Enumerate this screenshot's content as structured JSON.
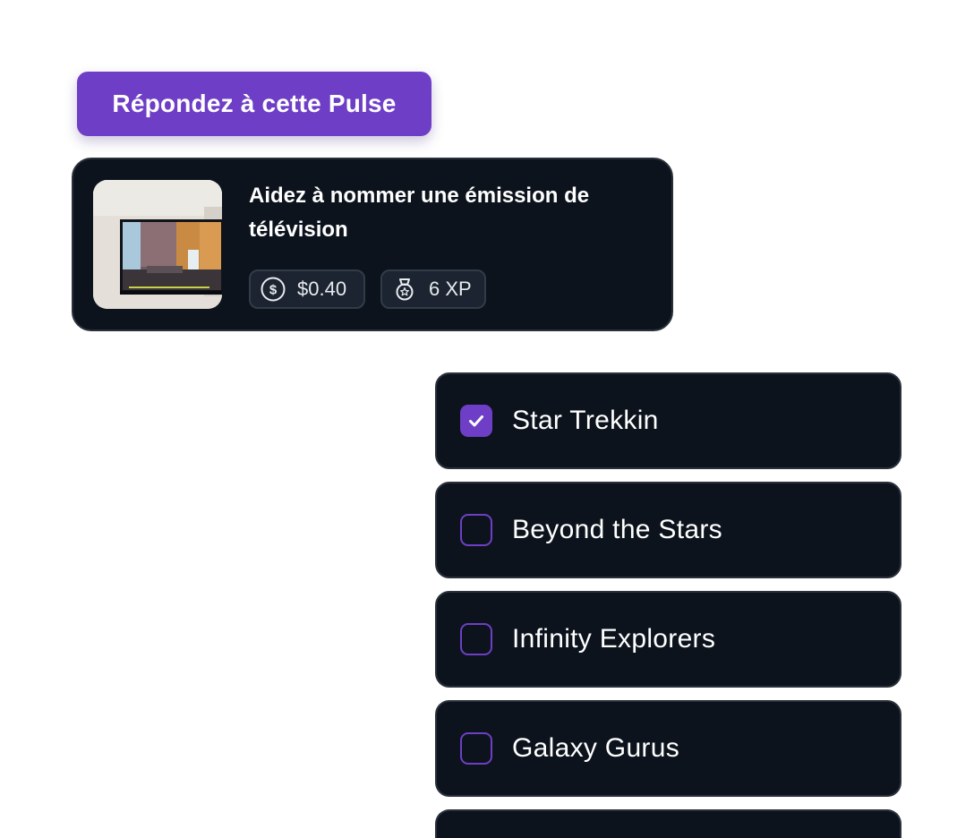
{
  "header": {
    "button_label": "Répondez à cette Pulse",
    "accent_color": "#6e3fc6"
  },
  "task": {
    "title": "Aidez à nommer une émission de télévision",
    "thumbnail_icon": "tv-photo",
    "reward": {
      "icon": "dollar-coin-icon",
      "value": "$0.40"
    },
    "xp": {
      "icon": "medal-icon",
      "value": "6 XP"
    }
  },
  "options": [
    {
      "label": "Star Trekkin",
      "checked": true
    },
    {
      "label": "Beyond the Stars",
      "checked": false
    },
    {
      "label": "Infinity Explorers",
      "checked": false
    },
    {
      "label": "Galaxy Gurus",
      "checked": false
    },
    {
      "label": "",
      "checked": false
    }
  ]
}
